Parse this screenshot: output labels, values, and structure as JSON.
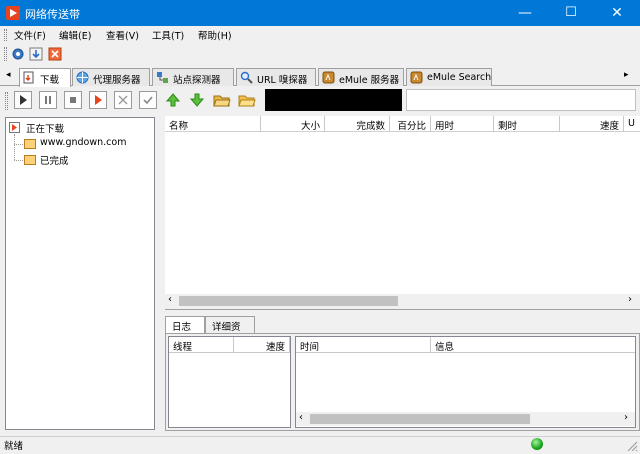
{
  "window": {
    "title": "网络传送带",
    "controls": {
      "minimize": "—",
      "maximize": "☐",
      "close": "✕"
    }
  },
  "menubar": [
    "文件(F)",
    "编辑(E)",
    "查看(V)",
    "工具(T)",
    "帮助(H)"
  ],
  "tabs": [
    {
      "label": "下载",
      "icon": "download-page-icon"
    },
    {
      "label": "代理服务器",
      "icon": "globe-icon"
    },
    {
      "label": "站点探测器",
      "icon": "network-icon"
    },
    {
      "label": "URL 嗅探器",
      "icon": "magnifier-icon"
    },
    {
      "label": "eMule 服务器",
      "icon": "emule-icon"
    },
    {
      "label": "eMule Search",
      "icon": "emule-icon"
    }
  ],
  "tree": {
    "root": "正在下载",
    "children": [
      "www.gndown.com",
      "已完成"
    ]
  },
  "list": {
    "columns": [
      "名称",
      "大小",
      "完成数",
      "百分比",
      "用时",
      "剩时",
      "速度",
      "U"
    ]
  },
  "log": {
    "tabs": [
      "日志",
      "详细资料"
    ],
    "left_columns": [
      "线程",
      "速度"
    ],
    "right_columns": [
      "时间",
      "信息"
    ]
  },
  "status": {
    "text": "就绪",
    "indicator_color": "#1aa41a"
  },
  "scroll": {
    "left_arrow": "‹",
    "right_arrow": "›"
  }
}
